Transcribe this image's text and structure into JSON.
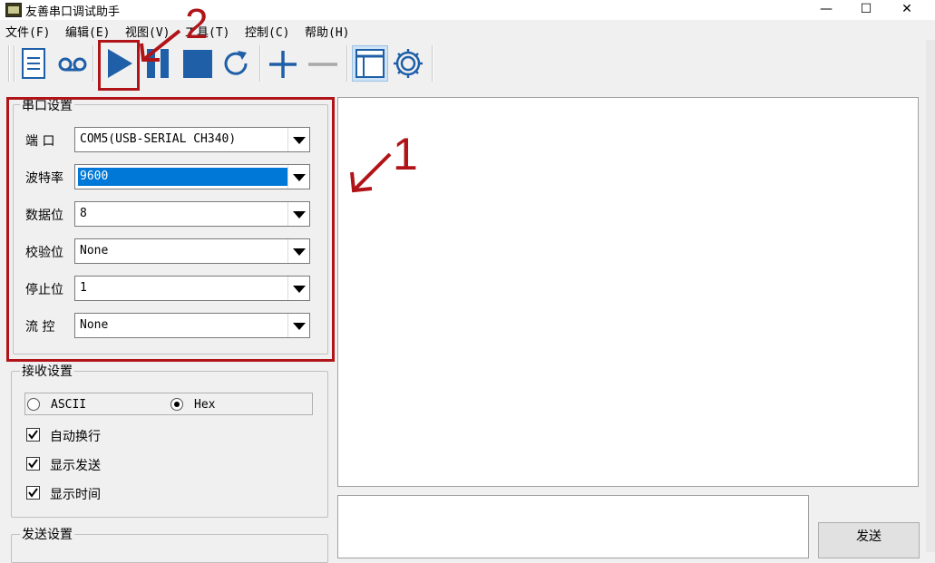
{
  "window": {
    "title": "友善串口调试助手",
    "minimize": "—",
    "maximize": "☐",
    "close": "✕"
  },
  "menu": [
    "文件(F)",
    "编辑(E)",
    "视图(V)",
    "工具(T)",
    "控制(C)",
    "帮助(H)"
  ],
  "toolbar": {
    "icons": [
      "new-document-icon",
      "record-icon",
      "play-icon",
      "pause-icon",
      "stop-icon",
      "refresh-icon",
      "add-icon",
      "remove-icon",
      "window-icon",
      "settings-gear-icon"
    ]
  },
  "serial_settings": {
    "legend": "串口设置",
    "rows": [
      {
        "label": "端  口",
        "value": "COM5(USB-SERIAL CH340)"
      },
      {
        "label": "波特率",
        "value": "9600"
      },
      {
        "label": "数据位",
        "value": "8"
      },
      {
        "label": "校验位",
        "value": "None"
      },
      {
        "label": "停止位",
        "value": "1"
      },
      {
        "label": "流  控",
        "value": "None"
      }
    ]
  },
  "receive_settings": {
    "legend": "接收设置",
    "mode_ascii": "ASCII",
    "mode_hex": "Hex",
    "selected_mode": "Hex",
    "options": [
      {
        "label": "自动换行",
        "checked": true
      },
      {
        "label": "显示发送",
        "checked": true
      },
      {
        "label": "显示时间",
        "checked": true
      }
    ]
  },
  "send_settings": {
    "legend": "发送设置"
  },
  "send_button": "发送",
  "annotations": {
    "label_1": "1",
    "label_2": "2",
    "color": "#b01418"
  },
  "colors": {
    "selection": "#0078d7",
    "play_blue": "#1e5fa8"
  }
}
